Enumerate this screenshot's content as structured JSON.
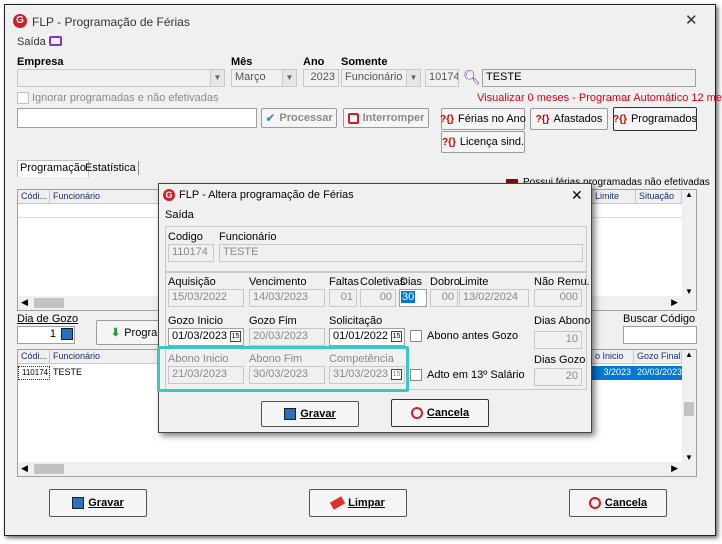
{
  "main": {
    "title": "FLP - Programação de Férias",
    "menu_saida": "Saída",
    "labels": {
      "empresa": "Empresa",
      "mes": "Mês",
      "ano": "Ano",
      "somente": "Somente"
    },
    "values": {
      "empresa": "",
      "mes": "Março",
      "ano": "2023",
      "somente": "Funcionário",
      "codigo": "10174",
      "nome": "TESTE"
    },
    "ignorar_label": "Ignorar programadas e não efetivadas",
    "visualizar_text": "Visualizar 0 meses - Programar Automático 12 meses",
    "processar": "Processar",
    "interromper": "Interromper",
    "ferias_no_ano": "Férias no Ano",
    "afastados": "Afastados",
    "programados": "Programados",
    "licenca_sind": "Licença sind.",
    "tab_programacao": "Programação",
    "tab_estatistica": "Estatística",
    "legend_text": "Possui férias programadas não efetivadas",
    "top_grid": {
      "cols": [
        "Códi...",
        "Funcionário",
        "Limite",
        "Situação"
      ]
    },
    "dia_de_gozo_label": "Dia de Gozo",
    "dia_de_gozo_value": "1",
    "programar_btn": "Progran",
    "buscar_codigo_label": "Buscar Código",
    "bottom_grid": {
      "cols": [
        "Códi...",
        "Funcionário",
        "o Inicio",
        "Gozo Final"
      ],
      "row": {
        "codigo": "110174",
        "funcionario": "TESTE",
        "inicio": "3/2023",
        "final": "20/03/2023"
      }
    },
    "gravar": "Gravar",
    "limpar": "Limpar",
    "cancela": "Cancela",
    "accent_color": "#0078d7"
  },
  "dialog": {
    "title": "FLP - Altera programação de Férias",
    "menu_saida": "Saída",
    "labels": {
      "codigo": "Codigo",
      "funcionario": "Funcionário",
      "aquisicao": "Aquisição",
      "vencimento": "Vencimento",
      "faltas": "Faltas",
      "coletivas": "Coletivas",
      "dias": "Dias",
      "dobro": "Dobro",
      "limite": "Limite",
      "nao_remu": "Não Remu.",
      "gozo_inicio": "Gozo Inicio",
      "gozo_fim": "Gozo Fim",
      "solicitacao": "Solicitação",
      "abono_antes": "Abono antes Gozo",
      "dias_abono": "Dias Abono",
      "abono_inicio": "Abono Inicio",
      "abono_fim": "Abono Fim",
      "competencia": "Competência",
      "adto_13": "Adto em 13º Salário",
      "dias_gozo": "Dias Gozo"
    },
    "values": {
      "codigo": "110174",
      "funcionario": "TESTE",
      "aquisicao": "15/03/2022",
      "vencimento": "14/03/2023",
      "faltas": "01",
      "coletivas": "00",
      "dias": "30",
      "dobro": "00",
      "limite": "13/02/2024",
      "nao_remu": "000",
      "gozo_inicio": "01/03/2023",
      "gozo_fim": "20/03/2023",
      "solicitacao": "01/01/2022",
      "dias_abono": "10",
      "abono_inicio": "21/03/2023",
      "abono_fim": "30/03/2023",
      "competencia": "31/03/2023",
      "dias_gozo": "20"
    },
    "gravar": "Gravar",
    "cancela": "Cancela",
    "highlight_color": "#3cc6c6"
  }
}
